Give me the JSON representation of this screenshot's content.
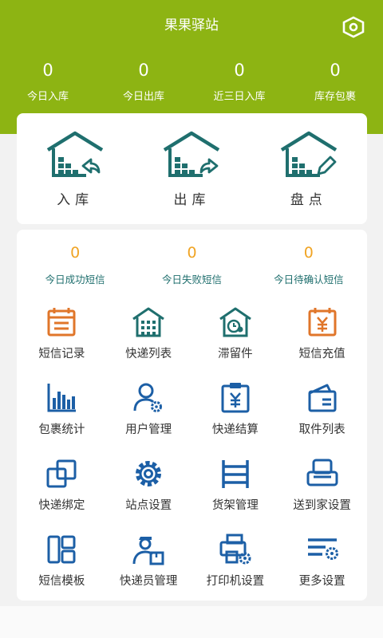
{
  "header": {
    "title": "果果驿站"
  },
  "stats": [
    {
      "value": "0",
      "label": "今日入库"
    },
    {
      "value": "0",
      "label": "今日出库"
    },
    {
      "value": "0",
      "label": "近三日入库"
    },
    {
      "value": "0",
      "label": "库存包裹"
    }
  ],
  "actions": [
    {
      "label": "入库",
      "icon": "warehouse-in-icon"
    },
    {
      "label": "出库",
      "icon": "warehouse-out-icon"
    },
    {
      "label": "盘点",
      "icon": "warehouse-check-icon"
    }
  ],
  "sms": [
    {
      "value": "0",
      "label": "今日成功短信"
    },
    {
      "value": "0",
      "label": "今日失败短信"
    },
    {
      "value": "0",
      "label": "今日待确认短信"
    }
  ],
  "menu": [
    {
      "label": "短信记录",
      "icon": "calendar-icon"
    },
    {
      "label": "快递列表",
      "icon": "building-icon"
    },
    {
      "label": "滞留件",
      "icon": "clock-house-icon"
    },
    {
      "label": "短信充值",
      "icon": "yen-calendar-icon"
    },
    {
      "label": "包裹统计",
      "icon": "bar-chart-icon"
    },
    {
      "label": "用户管理",
      "icon": "user-gear-icon"
    },
    {
      "label": "快递结算",
      "icon": "yen-clipboard-icon"
    },
    {
      "label": "取件列表",
      "icon": "wallet-icon"
    },
    {
      "label": "快递绑定",
      "icon": "link-squares-icon"
    },
    {
      "label": "站点设置",
      "icon": "gear-icon"
    },
    {
      "label": "货架管理",
      "icon": "shelf-icon"
    },
    {
      "label": "送到家设置",
      "icon": "armchair-icon"
    },
    {
      "label": "短信模板",
      "icon": "template-icon"
    },
    {
      "label": "快递员管理",
      "icon": "courier-icon"
    },
    {
      "label": "打印机设置",
      "icon": "printer-gear-icon"
    },
    {
      "label": "更多设置",
      "icon": "list-gear-icon"
    }
  ],
  "colors": {
    "header": "#8db413",
    "teal": "#1f6f6e",
    "orange": "#e0762a",
    "blue": "#1c5fa6",
    "sms_number": "#f0a424"
  }
}
